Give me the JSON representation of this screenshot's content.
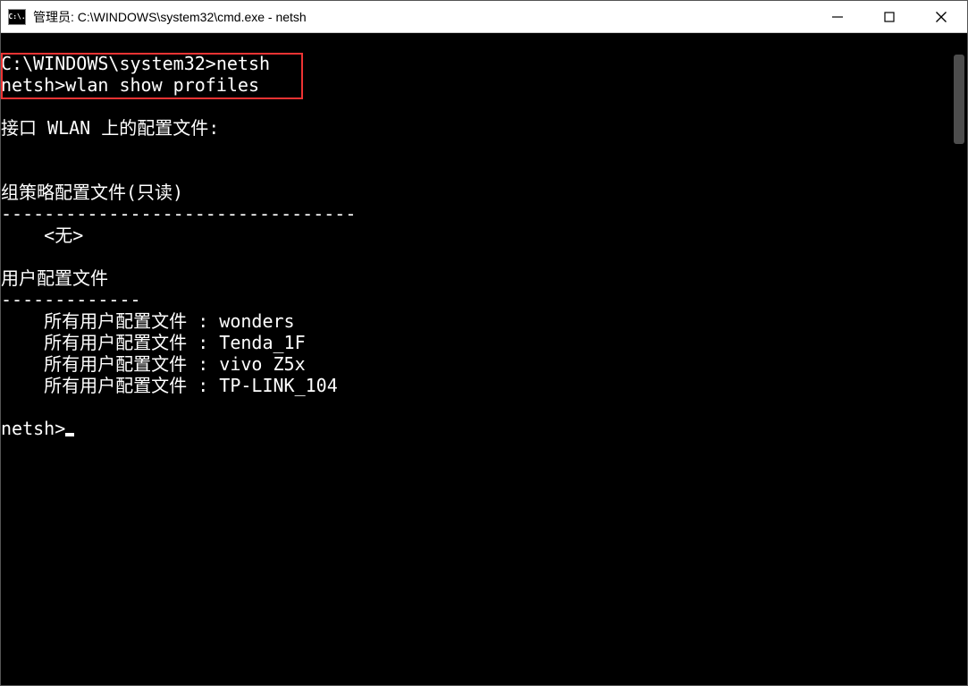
{
  "titlebar": {
    "icon_label": "C:\\.",
    "title": "管理员: C:\\WINDOWS\\system32\\cmd.exe - netsh"
  },
  "terminal": {
    "line1": "C:\\WINDOWS\\system32>netsh",
    "line2": "netsh>wlan show profiles",
    "blank1": "",
    "interface_header": "接口 WLAN 上的配置文件:",
    "blank2": "",
    "blank3": "",
    "gp_header": "组策略配置文件(只读)",
    "gp_divider": "---------------------------------",
    "gp_none": "    <无>",
    "blank4": "",
    "user_header": "用户配置文件",
    "user_divider": "-------------",
    "profile1": "    所有用户配置文件 : wonders",
    "profile2": "    所有用户配置文件 : Tenda_1F",
    "profile3": "    所有用户配置文件 : vivo Z5x",
    "profile4": "    所有用户配置文件 : TP-LINK_104",
    "blank5": "",
    "prompt": "netsh>"
  }
}
